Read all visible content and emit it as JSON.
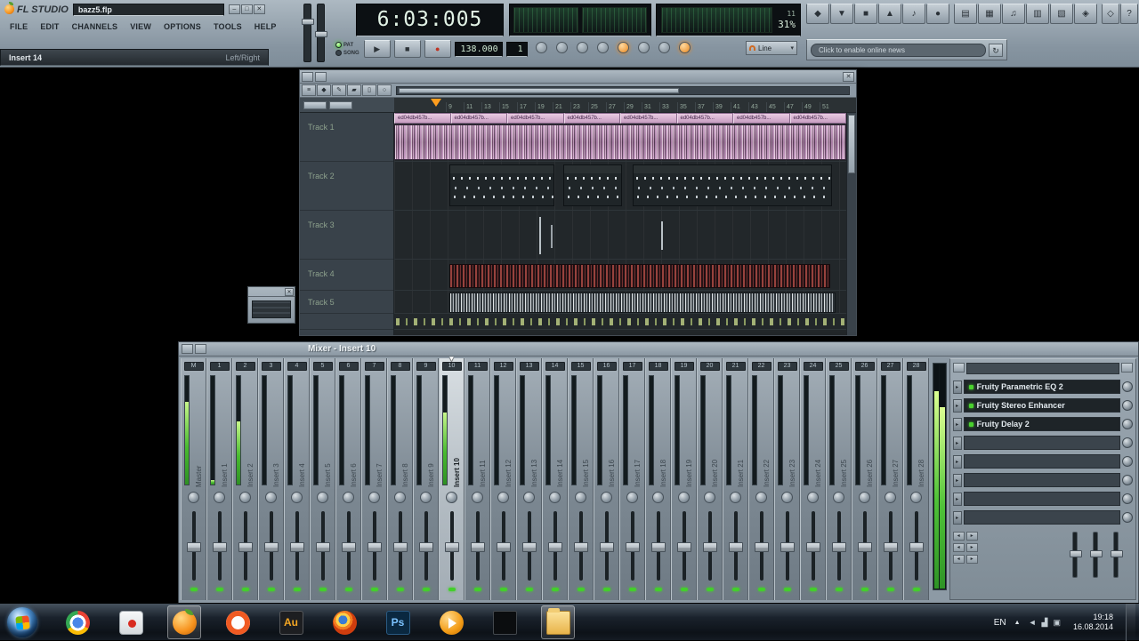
{
  "titlebar": {
    "logo": "FL STUDIO",
    "filename": "bazz5.flp",
    "min": "–",
    "max": "□",
    "close": "✕"
  },
  "menu": [
    "FILE",
    "EDIT",
    "CHANNELS",
    "VIEW",
    "OPTIONS",
    "TOOLS",
    "HELP"
  ],
  "hint": {
    "left": "Insert 14",
    "right": "Left/Right"
  },
  "transport": {
    "time": "6:03:005",
    "tempo": "138.000",
    "pattern": "1",
    "pat_label": "PAT",
    "song_label": "SONG",
    "play": "▶",
    "stop": "■",
    "rec": "●",
    "poly": "11",
    "cpu": "31%",
    "snap_label": "Line",
    "snap_arrow": "▾"
  },
  "record_leds": [
    {
      "name": "typing-keyboard",
      "lit": false
    },
    {
      "name": "metronome",
      "lit": false
    },
    {
      "name": "wait-for-input",
      "lit": false
    },
    {
      "name": "countdown",
      "lit": false
    },
    {
      "name": "blend-recording",
      "lit": true
    },
    {
      "name": "loop-recording",
      "lit": false
    },
    {
      "name": "step-edit",
      "lit": false
    },
    {
      "name": "multilink",
      "lit": true
    }
  ],
  "news": {
    "text": "Click to enable online news",
    "refresh": "↻"
  },
  "toolbar_icons": {
    "groups": [
      [
        {
          "name": "tool-options",
          "glyph": "◆"
        },
        {
          "name": "open-file",
          "glyph": "▼"
        },
        {
          "name": "save",
          "glyph": "■"
        },
        {
          "name": "export",
          "glyph": "▲"
        },
        {
          "name": "midi-settings",
          "glyph": "♪"
        },
        {
          "name": "audio-settings",
          "glyph": "●"
        }
      ],
      [
        {
          "name": "playlist",
          "glyph": "▤"
        },
        {
          "name": "step-sequencer",
          "glyph": "▦"
        },
        {
          "name": "piano-roll",
          "glyph": "♫"
        },
        {
          "name": "browser",
          "glyph": "▥"
        },
        {
          "name": "mixer",
          "glyph": "▧"
        },
        {
          "name": "plugin-picker",
          "glyph": "◈"
        }
      ],
      [
        {
          "name": "about",
          "glyph": "◇"
        },
        {
          "name": "help",
          "glyph": "?"
        }
      ]
    ]
  },
  "miniwin": {
    "close": "✕"
  },
  "playlist": {
    "toolbar_icons": [
      {
        "name": "playlist-menu",
        "glyph": "≡"
      },
      {
        "name": "snap-magnet",
        "glyph": "◆"
      },
      {
        "name": "draw-tool",
        "glyph": "✎"
      },
      {
        "name": "paint-tool",
        "glyph": "▰"
      },
      {
        "name": "slip-tool",
        "glyph": "▯"
      },
      {
        "name": "zoom-tool",
        "glyph": "○"
      }
    ],
    "ruler": [
      "9",
      "11",
      "13",
      "15",
      "17",
      "19",
      "21",
      "23",
      "25",
      "27",
      "29",
      "31",
      "33",
      "35",
      "37",
      "39",
      "41",
      "43",
      "45",
      "47",
      "49",
      "51"
    ],
    "audio_clip_label": "ed04db457b...",
    "audio_clip_count": 8,
    "tracks": [
      {
        "name": "Track 1",
        "type": "audio"
      },
      {
        "name": "Track 2",
        "type": "midi"
      },
      {
        "name": "Track 3",
        "type": "sparse"
      },
      {
        "name": "Track 4",
        "type": "red"
      },
      {
        "name": "Track 5",
        "type": "stripes"
      }
    ]
  },
  "mixer": {
    "title": "Mixer - Insert 10",
    "sel_marker": "▼",
    "selected_meter": 88,
    "strips": [
      {
        "num": "M",
        "name": "Master",
        "level": 76
      },
      {
        "num": "1",
        "name": "Insert 1",
        "level": 4
      },
      {
        "num": "2",
        "name": "Insert 2",
        "level": 58
      },
      {
        "num": "3",
        "name": "Insert 3",
        "level": 0
      },
      {
        "num": "4",
        "name": "Insert 4",
        "level": 0
      },
      {
        "num": "5",
        "name": "Insert 5",
        "level": 0
      },
      {
        "num": "6",
        "name": "Insert 6",
        "level": 0
      },
      {
        "num": "7",
        "name": "Insert 7",
        "level": 0
      },
      {
        "num": "8",
        "name": "Insert 8",
        "level": 0
      },
      {
        "num": "9",
        "name": "Insert 9",
        "level": 0
      },
      {
        "num": "10",
        "name": "Insert 10",
        "level": 66,
        "selected": true
      },
      {
        "num": "11",
        "name": "Insert 11",
        "level": 0
      },
      {
        "num": "12",
        "name": "Insert 12",
        "level": 0
      },
      {
        "num": "13",
        "name": "Insert 13",
        "level": 0
      },
      {
        "num": "14",
        "name": "Insert 14",
        "level": 0
      },
      {
        "num": "15",
        "name": "Insert 15",
        "level": 0
      },
      {
        "num": "16",
        "name": "Insert 16",
        "level": 0
      },
      {
        "num": "17",
        "name": "Insert 17",
        "level": 0
      },
      {
        "num": "18",
        "name": "Insert 18",
        "level": 0
      },
      {
        "num": "19",
        "name": "Insert 19",
        "level": 0
      },
      {
        "num": "20",
        "name": "Insert 20",
        "level": 0
      },
      {
        "num": "21",
        "name": "Insert 21",
        "level": 0
      },
      {
        "num": "22",
        "name": "Insert 22",
        "level": 0
      },
      {
        "num": "23",
        "name": "Insert 23",
        "level": 0
      },
      {
        "num": "24",
        "name": "Insert 24",
        "level": 0
      },
      {
        "num": "25",
        "name": "Insert 25",
        "level": 0
      },
      {
        "num": "26",
        "name": "Insert 26",
        "level": 0
      },
      {
        "num": "27",
        "name": "Insert 27",
        "level": 0
      },
      {
        "num": "28",
        "name": "Insert 28",
        "level": 0
      }
    ],
    "fx": {
      "arrow": "▸",
      "nav_prev": "◂",
      "nav_next": "▸",
      "slots": [
        {
          "name": "Fruity Parametric EQ 2",
          "filled": true
        },
        {
          "name": "Fruity Stereo Enhancer",
          "filled": true
        },
        {
          "name": "Fruity Delay 2",
          "filled": true
        },
        {
          "name": "",
          "filled": false
        },
        {
          "name": "",
          "filled": false
        },
        {
          "name": "",
          "filled": false
        },
        {
          "name": "",
          "filled": false
        },
        {
          "name": "",
          "filled": false
        }
      ]
    }
  },
  "taskbar": {
    "icons": [
      {
        "name": "chrome"
      },
      {
        "name": "screen-recorder"
      },
      {
        "name": "fl-studio",
        "active": true
      },
      {
        "name": "origin"
      },
      {
        "name": "audition",
        "label": "Au"
      },
      {
        "name": "firefox"
      },
      {
        "name": "photoshop",
        "label": "Ps"
      },
      {
        "name": "media-player"
      },
      {
        "name": "console"
      },
      {
        "name": "explorer",
        "active": true
      }
    ],
    "tray": {
      "lang": "EN",
      "arrow": "▲",
      "icons": [
        {
          "name": "tray-volume-icon",
          "glyph": "◄"
        },
        {
          "name": "tray-network-icon",
          "glyph": "▟"
        },
        {
          "name": "tray-center-icon",
          "glyph": "▣"
        }
      ],
      "time": "19:18",
      "date": "16.08.2014"
    }
  }
}
